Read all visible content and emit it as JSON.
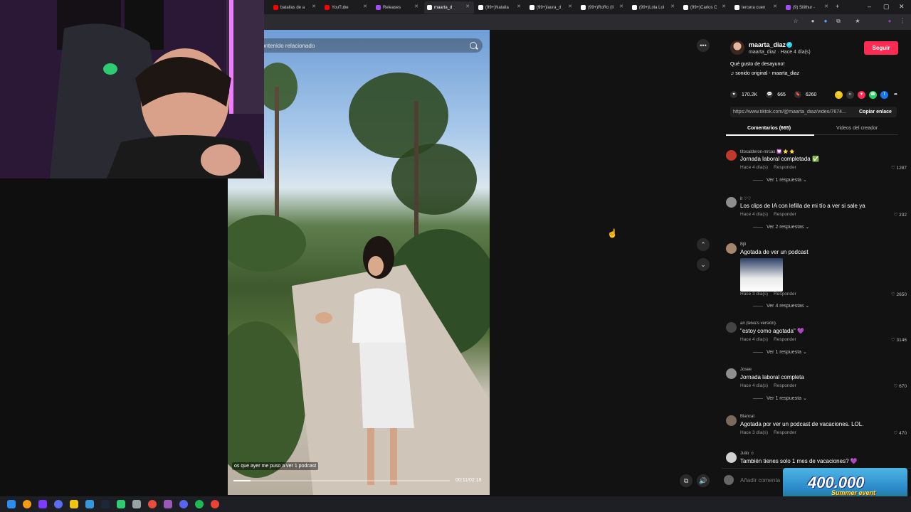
{
  "browser": {
    "tabs": [
      {
        "label": "batallas de a",
        "color": "#ff0000"
      },
      {
        "label": "YouTube",
        "color": "#ff0000"
      },
      {
        "label": "Releases",
        "color": "#a64dff"
      },
      {
        "label": "maarta_d",
        "color": "#ffffff"
      },
      {
        "label": "(99+)Natalia",
        "color": "#ffffff"
      },
      {
        "label": "(99+)laura_d",
        "color": "#ffffff"
      },
      {
        "label": "(99+)RoRo (II",
        "color": "#ffffff"
      },
      {
        "label": "(99+)Lola Lol",
        "color": "#ffffff"
      },
      {
        "label": "(99+)Carlos C",
        "color": "#ffffff"
      },
      {
        "label": "tercera cuen",
        "color": "#ffffff"
      },
      {
        "label": "(9) Silithur -",
        "color": "#a64dff"
      }
    ],
    "new_tab": "+",
    "window_controls": [
      "–",
      "▢",
      "✕"
    ]
  },
  "video": {
    "search_placeholder": "ontenido relacionado",
    "caption": "os que ayer me puso a ver 1 podcast",
    "time": "00:11/02:18",
    "progress": 0.08
  },
  "controls": {
    "more": "•••",
    "up": "⌃",
    "down": "⌄"
  },
  "post": {
    "username": "maarta_diaz",
    "verified_mark": "✓",
    "userline": "maarta_diaz · Hace 4 día(s)",
    "follow": "Seguir",
    "description": "Qué gusto de desayuno!",
    "sound": "♫  sonido original - maarta_diaz",
    "likes": "170.2K",
    "comments": "665",
    "saves": "6260",
    "link": "https://www.tiktok.com/@maarta_diaz/video/7674...",
    "copy_link": "Copiar enlace",
    "tab_comments": "Comentarios (665)",
    "tab_videos": "Videos del creador"
  },
  "comments": [
    {
      "user": "titocalderon-mrcas 💟 ⭐ ⭐",
      "text": "Jornada laboral completada ✅",
      "time": "Hace 4 día(s)",
      "reply": "Responder",
      "likes": "♡ 1287",
      "more": "Ver 1 respuesta ⌄",
      "avatar": "#c0392b"
    },
    {
      "user": "it ♡♡",
      "text": "Los clips de IA con lefilla de mi tío a ver si sale ya",
      "time": "Hace 4 día(s)",
      "reply": "Responder",
      "likes": "♡ 232",
      "more": "Ver 2 respuestas ⌄",
      "avatar": "#8d8d8d"
    },
    {
      "user": "Bjti",
      "text": "Agotada de ver un podcast",
      "time": "Hace 3 día(s)",
      "reply": "Responder",
      "likes": "♡ 2650",
      "more": "Ver 4 respuestas ⌄",
      "avatar": "#a5856b"
    },
    {
      "user": "an (leiva's versión).",
      "text": "\"estoy como agotada\" 💜",
      "time": "Hace 4 día(s)",
      "reply": "Responder",
      "likes": "♡ 3146",
      "more": "Ver 1 respuesta ⌄",
      "avatar": "#444"
    },
    {
      "user": "Josee",
      "text": "Jornada laboral completa",
      "time": "Hace 4 día(s)",
      "reply": "Responder",
      "likes": "♡ 670",
      "more": "Ver 1 respuesta ⌄",
      "avatar": "#8e8e8e"
    },
    {
      "user": "Blancat",
      "text": "Agotada por ver un podcast de vacaciones. LOL.",
      "time": "Hace 3 día(s)",
      "reply": "Responder",
      "likes": "♡ 470",
      "more": "",
      "avatar": "#7b6a5c"
    },
    {
      "user": "Julio ☺",
      "text": "También tienes solo 1 mes de vacaciones? 💜",
      "time": "",
      "reply": "",
      "likes": "",
      "more": "",
      "avatar": "#d0d0d0"
    }
  ],
  "add_comment_placeholder": "Añadir comenta",
  "event": {
    "number": "400.000",
    "subtitle": "Summer event"
  },
  "colors": {
    "follow": "#fe2c55",
    "accent": "#20d5ec"
  }
}
